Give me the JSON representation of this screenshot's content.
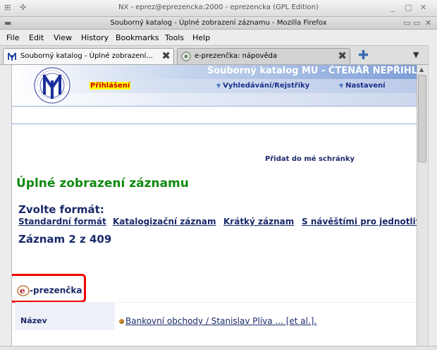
{
  "nx_window": {
    "title": "NX - eprez@eprezencka:2000 - eprezencka (GPL Edition)"
  },
  "browser": {
    "title": "Souborný katalog - Úplné zobrazení záznamu - Mozilla Firefox"
  },
  "menu": {
    "items": [
      "File",
      "Edit",
      "View",
      "History",
      "Bookmarks",
      "Tools",
      "Help"
    ]
  },
  "tabs": [
    {
      "label": "Souborný katalog - Úplné zobrazení...",
      "active": true
    },
    {
      "label": "e-prezenčka: nápověda",
      "active": false
    }
  ],
  "page": {
    "banner_title": "Souborný katalog MU - ČTENÁŘ NEPŘIHL",
    "logo_text": "UNIVERSITAS MASARYKIANA BRUNENSIS",
    "login": "Přihlášení",
    "nav": [
      "Vyhledávání/Rejstříky",
      "Nastavení"
    ],
    "add_to_basket": "Přidat do mé schránky",
    "heading": "Úplné zobrazení záznamu",
    "format_label": "Zvolte formát:",
    "formats": [
      "Standardní formát",
      "Katalogizační záznam",
      "Krátký záznam",
      "S návěštími pro jednotlivá"
    ],
    "record_count": "Záznam 2 z 409",
    "eprezencka_text": "-prezenčka",
    "field": {
      "label": "Název",
      "value": "Bankovní obchody / Stanislav Plíva ... [et al.]."
    }
  },
  "colors": {
    "heading_green": "#108a10",
    "link_navy": "#1a2a6a",
    "highlight_red": "#ee0000",
    "login_bg": "#ffff00"
  }
}
